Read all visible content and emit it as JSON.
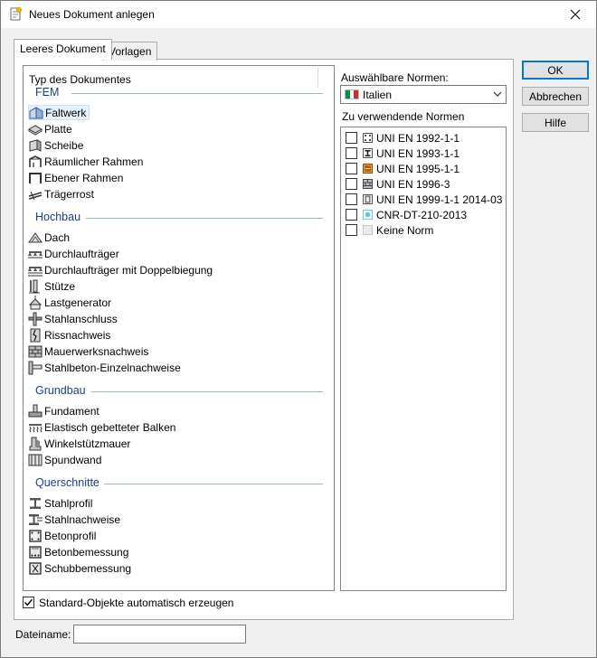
{
  "window": {
    "title": "Neues Dokument anlegen",
    "close_icon": "close-icon"
  },
  "tabs": [
    {
      "label": "Leeres Dokument",
      "active": true
    },
    {
      "label": "Vorlagen",
      "active": false
    }
  ],
  "doc_list": {
    "header": "Typ des Dokumentes",
    "groups": [
      {
        "title": "FEM",
        "items": [
          {
            "label": "Faltwerk",
            "icon": "folded-plate-icon",
            "selected": true
          },
          {
            "label": "Platte",
            "icon": "plate-icon"
          },
          {
            "label": "Scheibe",
            "icon": "wall-icon"
          },
          {
            "label": "Räumlicher Rahmen",
            "icon": "space-frame-icon"
          },
          {
            "label": "Ebener Rahmen",
            "icon": "plane-frame-icon"
          },
          {
            "label": "Trägerrost",
            "icon": "girder-grid-icon"
          }
        ]
      },
      {
        "title": "Hochbau",
        "items": [
          {
            "label": "Dach",
            "icon": "roof-icon"
          },
          {
            "label": "Durchlaufträger",
            "icon": "continuous-beam-icon"
          },
          {
            "label": "Durchlaufträger mit Doppelbiegung",
            "icon": "biaxial-beam-icon"
          },
          {
            "label": "Stütze",
            "icon": "column-icon"
          },
          {
            "label": "Lastgenerator",
            "icon": "load-generator-icon"
          },
          {
            "label": "Stahlanschluss",
            "icon": "steel-connection-icon"
          },
          {
            "label": "Rissnachweis",
            "icon": "crack-check-icon"
          },
          {
            "label": "Mauerwerksnachweis",
            "icon": "masonry-icon"
          },
          {
            "label": "Stahlbeton-Einzelnachweise",
            "icon": "rc-check-icon"
          }
        ]
      },
      {
        "title": "Grundbau",
        "items": [
          {
            "label": "Fundament",
            "icon": "foundation-icon"
          },
          {
            "label": "Elastisch gebetteter Balken",
            "icon": "elastic-beam-icon"
          },
          {
            "label": "Winkelstützmauer",
            "icon": "retaining-wall-icon"
          },
          {
            "label": "Spundwand",
            "icon": "sheet-pile-icon"
          }
        ]
      },
      {
        "title": "Querschnitte",
        "items": [
          {
            "label": "Stahlprofil",
            "icon": "steel-profile-icon"
          },
          {
            "label": "Stahlnachweise",
            "icon": "steel-check-icon"
          },
          {
            "label": "Betonprofil",
            "icon": "concrete-profile-icon"
          },
          {
            "label": "Betonbemessung",
            "icon": "concrete-design-icon"
          },
          {
            "label": "Schubbemessung",
            "icon": "shear-design-icon"
          }
        ]
      }
    ]
  },
  "norms": {
    "available_label": "Auswählbare Normen:",
    "selected_country": "Italien",
    "flag_colors": [
      "#009246",
      "#ffffff",
      "#ce2b37"
    ],
    "used_label": "Zu verwendende Normen",
    "items": [
      {
        "label": "UNI EN 1992-1-1",
        "icon": "concrete-norm-icon",
        "checked": false
      },
      {
        "label": "UNI EN 1993-1-1",
        "icon": "steel-norm-icon",
        "checked": false
      },
      {
        "label": "UNI EN 1995-1-1",
        "icon": "timber-norm-icon",
        "checked": false
      },
      {
        "label": "UNI EN 1996-3",
        "icon": "masonry-norm-icon",
        "checked": false
      },
      {
        "label": "UNI EN 1999-1-1 2014-03",
        "icon": "aluminium-norm-icon",
        "checked": false
      },
      {
        "label": "CNR-DT-210-2013",
        "icon": "glass-norm-icon",
        "checked": false
      },
      {
        "label": "Keine Norm",
        "icon": "no-norm-icon",
        "checked": false
      }
    ]
  },
  "buttons": {
    "ok": "OK",
    "cancel": "Abbrechen",
    "help": "Hilfe"
  },
  "footer": {
    "auto_create_label": "Standard-Objekte automatisch erzeugen",
    "auto_create_checked": true,
    "filename_label": "Dateiname:",
    "filename_value": ""
  }
}
